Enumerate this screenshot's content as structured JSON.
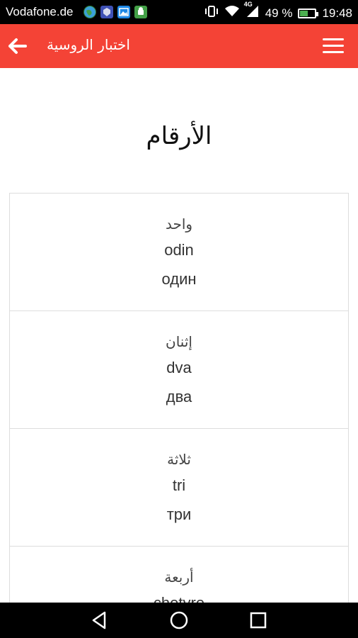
{
  "status_bar": {
    "carrier": "Vodafone.de",
    "network": "4G",
    "battery_percent": "49 %",
    "battery_level": 0.49,
    "time": "19:48",
    "notification_icons": [
      "globe-icon",
      "shield-app-icon",
      "image-icon",
      "android-app-icon"
    ],
    "colors": {
      "background": "#000000",
      "text": "#ffffff",
      "battery_fill": "#4caf50"
    }
  },
  "app_bar": {
    "title": "اختبار الروسية",
    "back_icon": "arrow-left-icon",
    "menu_icon": "hamburger-menu-icon",
    "color": "#f44336"
  },
  "main": {
    "title": "الأرقام",
    "cards": [
      {
        "arabic": "واحد",
        "translit": "odin",
        "cyrillic": "один"
      },
      {
        "arabic": "إثنان",
        "translit": "dva",
        "cyrillic": "два"
      },
      {
        "arabic": "ثلاثة",
        "translit": "tri",
        "cyrillic": "три"
      },
      {
        "arabic": "أربعة",
        "translit": "chetyre",
        "cyrillic": ""
      }
    ]
  },
  "nav_bar": {
    "buttons": [
      "back-triangle-icon",
      "home-circle-icon",
      "recents-square-icon"
    ]
  }
}
